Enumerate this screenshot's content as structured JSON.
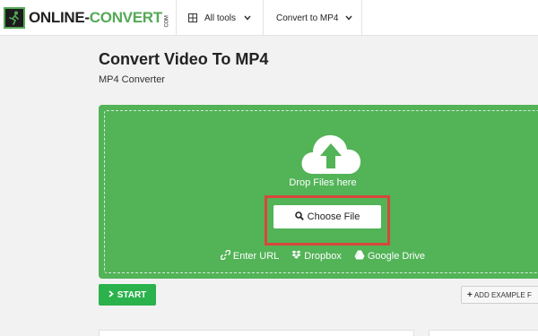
{
  "header": {
    "logo": {
      "text_main": "ONLINE-",
      "text_accent": "CONV",
      "text_accent2": "ERT",
      "text_suffix": "",
      "tld": "COM",
      "icon": "runner-logo-icon"
    },
    "nav": [
      {
        "label": "All tools",
        "icon": "grid-icon",
        "chevron": "chevron-down-icon"
      },
      {
        "label": "Convert to MP4",
        "chevron": "chevron-down-icon"
      }
    ]
  },
  "page": {
    "title": "Convert Video To MP4",
    "subtitle": "MP4 Converter"
  },
  "dropzone": {
    "icon": "cloud-upload-icon",
    "drop_text": "Drop Files here",
    "choose_button": {
      "label": "Choose File",
      "icon": "search-icon"
    },
    "sources": [
      {
        "label": "Enter URL",
        "icon": "link-icon"
      },
      {
        "label": "Dropbox",
        "icon": "dropbox-icon"
      },
      {
        "label": "Google Drive",
        "icon": "google-drive-icon"
      }
    ],
    "colors": {
      "background": "#52b357",
      "highlight": "#d9463b"
    }
  },
  "actions": {
    "start": {
      "label": "START",
      "icon": "chevron-right-icon",
      "color": "#2bb24c"
    },
    "add_example": {
      "label": "ADD EXAMPLE F",
      "icon": "plus-icon"
    }
  }
}
